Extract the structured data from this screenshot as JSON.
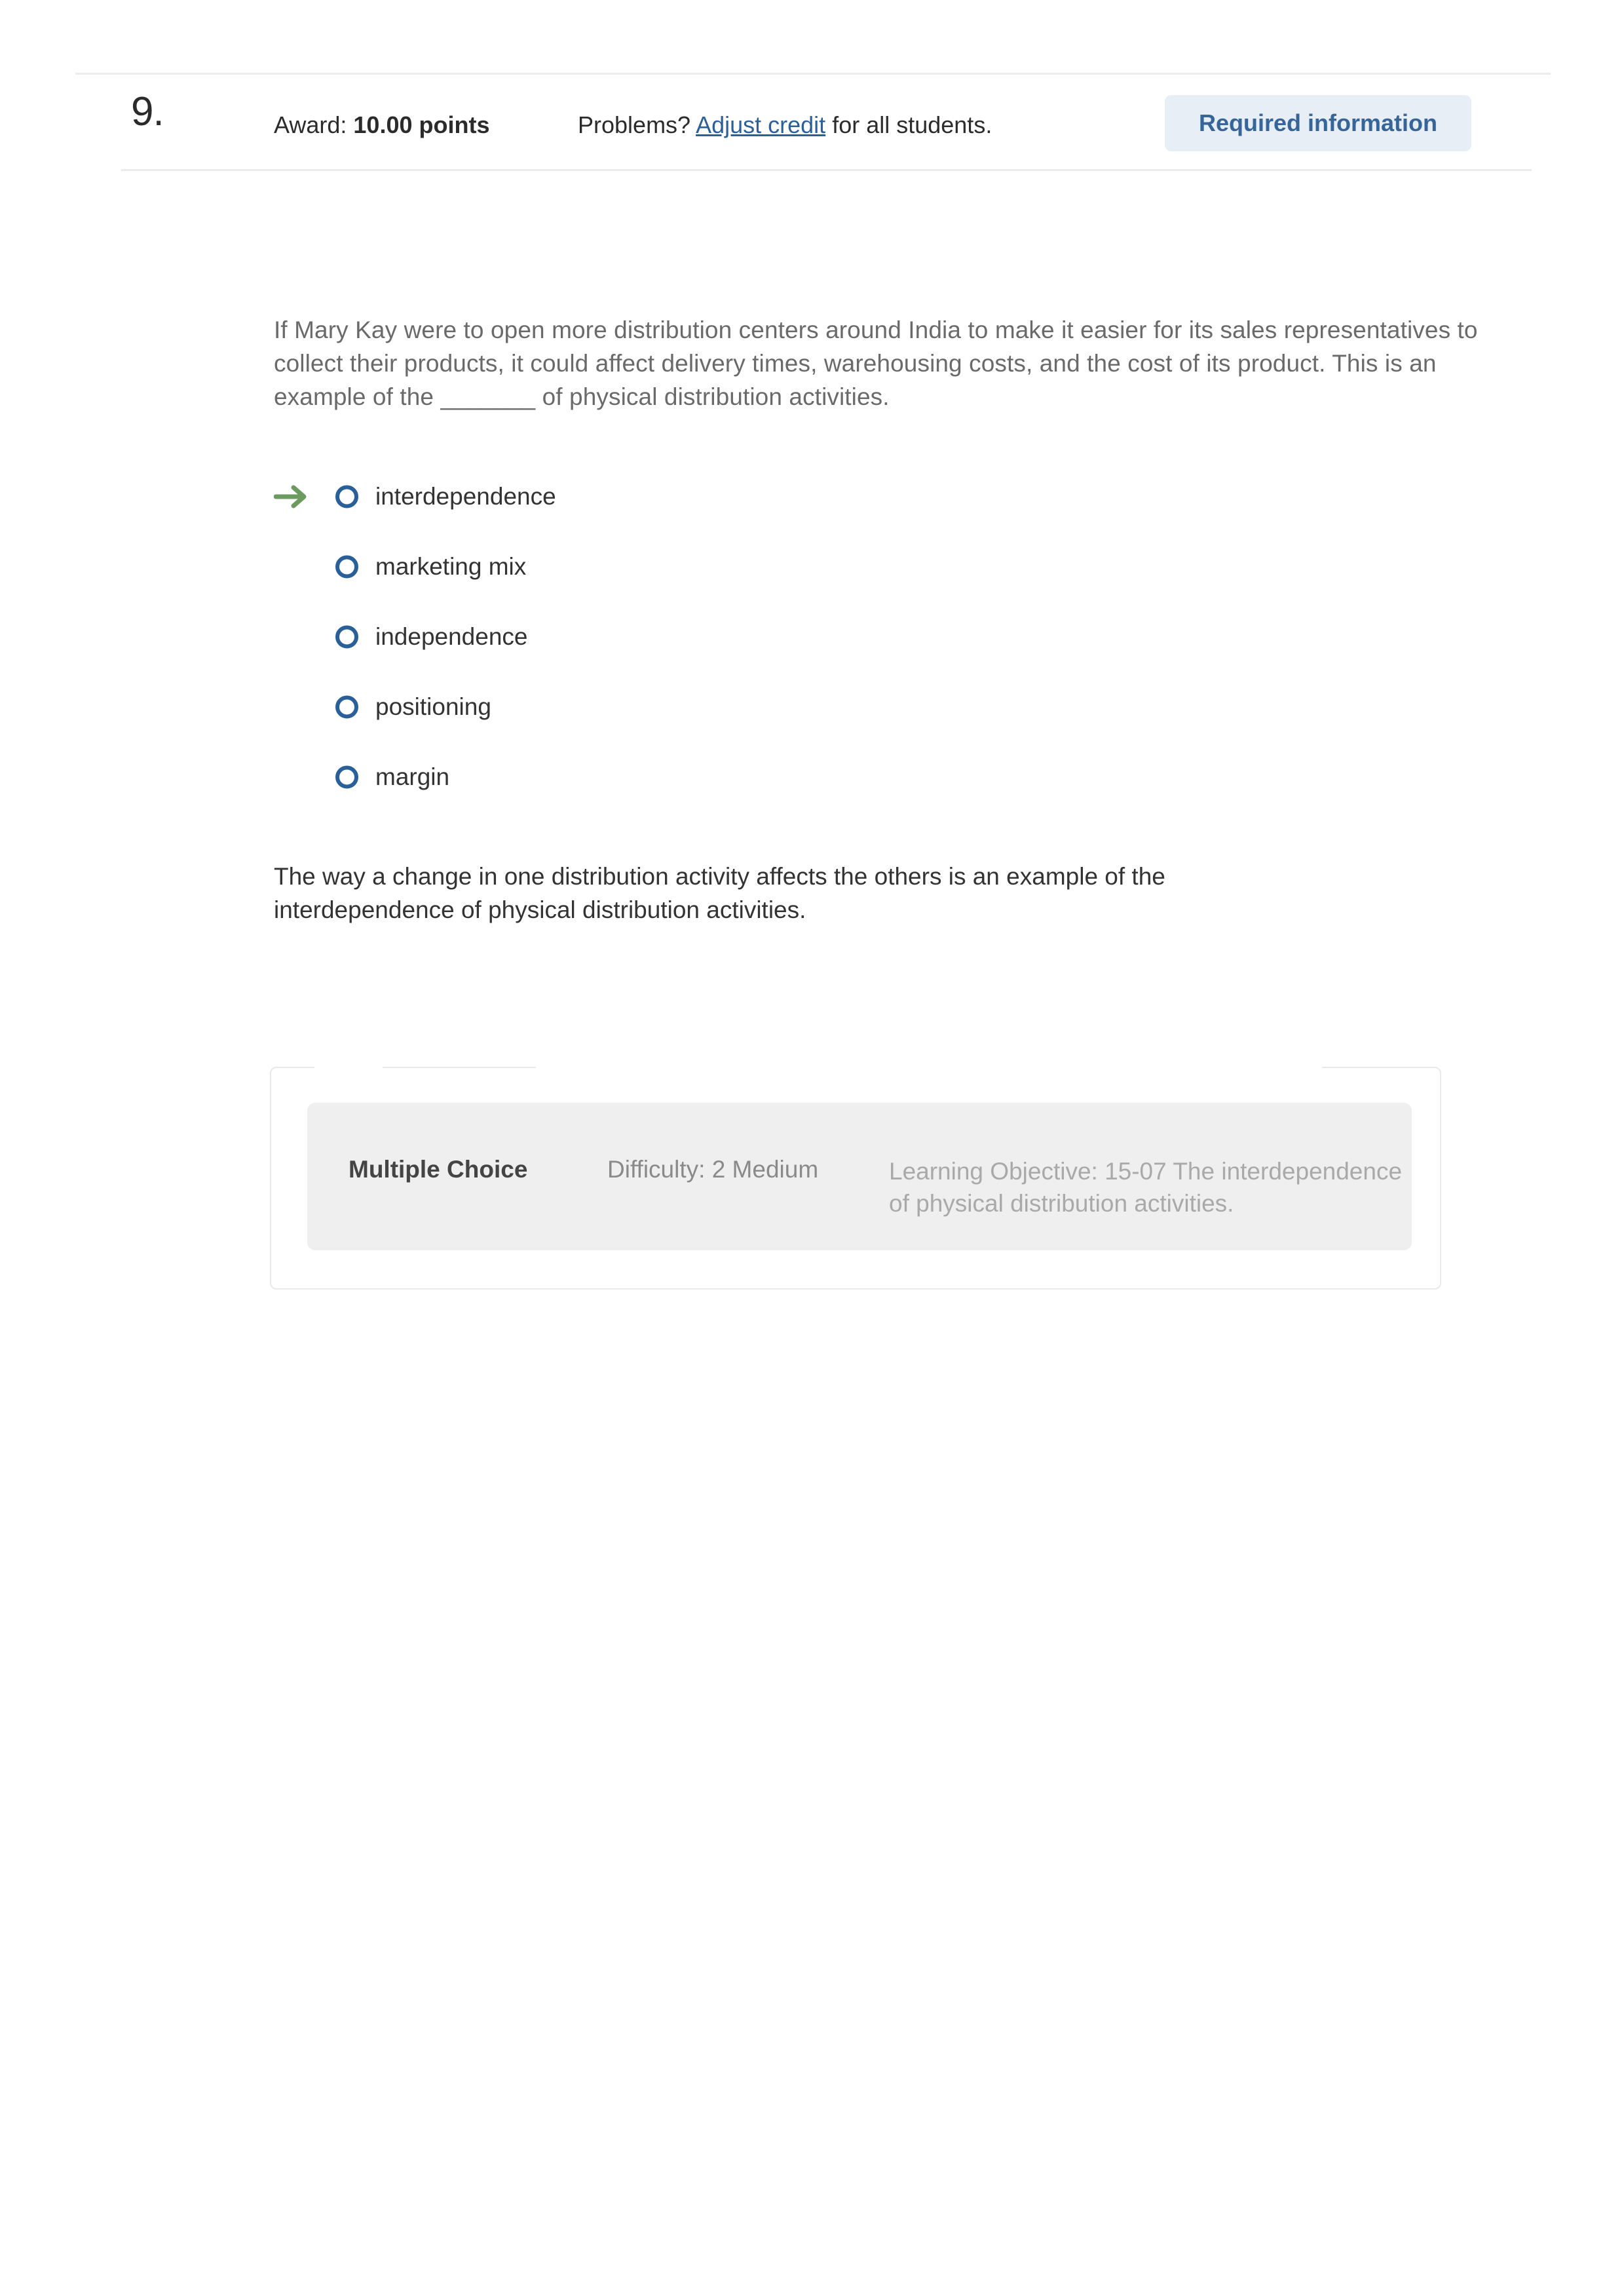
{
  "header": {
    "question_number": "9.",
    "award_label": "Award: ",
    "award_points": "10.00 points",
    "problems_prefix": "Problems? ",
    "adjust_credit_link": "Adjust credit",
    "problems_suffix": " for all students.",
    "required_badge": "Required information"
  },
  "question": {
    "stem": "If Mary Kay were to open more distribution centers around India to make it easier for its sales representatives to collect their products, it could affect delivery times, warehousing costs, and the cost of its product. This is an example of the _______ of physical distribution activities.",
    "options": [
      {
        "label": "interdependence",
        "selected": false,
        "correct": true
      },
      {
        "label": "marketing mix",
        "selected": false,
        "correct": false
      },
      {
        "label": "independence",
        "selected": false,
        "correct": false
      },
      {
        "label": "positioning",
        "selected": false,
        "correct": false
      },
      {
        "label": "margin",
        "selected": false,
        "correct": false
      }
    ],
    "explanation": "The way a change in one distribution activity affects the others is an example of the interdependence of physical distribution activities."
  },
  "meta": {
    "question_type": "Multiple Choice",
    "difficulty": "Difficulty: 2 Medium",
    "learning_objective": "Learning Objective: 15-07 The interdependence of physical distribution activities."
  },
  "colors": {
    "badge_background": "#e8eef5",
    "badge_text": "#36659a",
    "link": "#2c6099",
    "radio_ring": "#2a6099",
    "answer_arrow": "#6b9b5f",
    "stem_text": "#6a6a6a",
    "explanation_text": "#333333",
    "meta_box_background": "#efefef"
  }
}
